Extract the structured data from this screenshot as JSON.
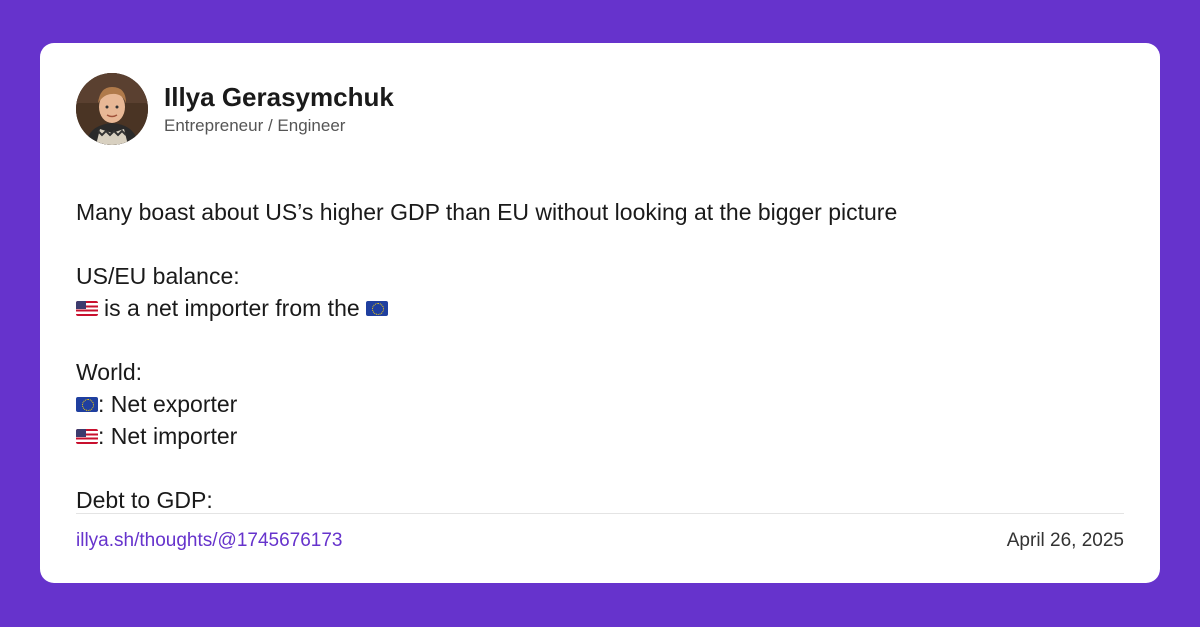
{
  "author": {
    "name": "Illya Gerasymchuk",
    "title": "Entrepreneur / Engineer"
  },
  "post": {
    "line1": "Many boast about US’s higher GDP than EU without looking at the bigger picture",
    "line2": "US/EU balance:",
    "line3": "is a net importer from the",
    "line4": "World:",
    "line5": ": Net exporter",
    "line6": ": Net importer",
    "line7": "Debt to GDP:"
  },
  "flags": {
    "us": "us-flag-icon",
    "eu": "eu-flag-icon"
  },
  "footer": {
    "link": "illya.sh/thoughts/@1745676173",
    "date": "April 26, 2025"
  },
  "colors": {
    "background": "#6633cc",
    "link": "#6633cc",
    "card": "#ffffff"
  }
}
